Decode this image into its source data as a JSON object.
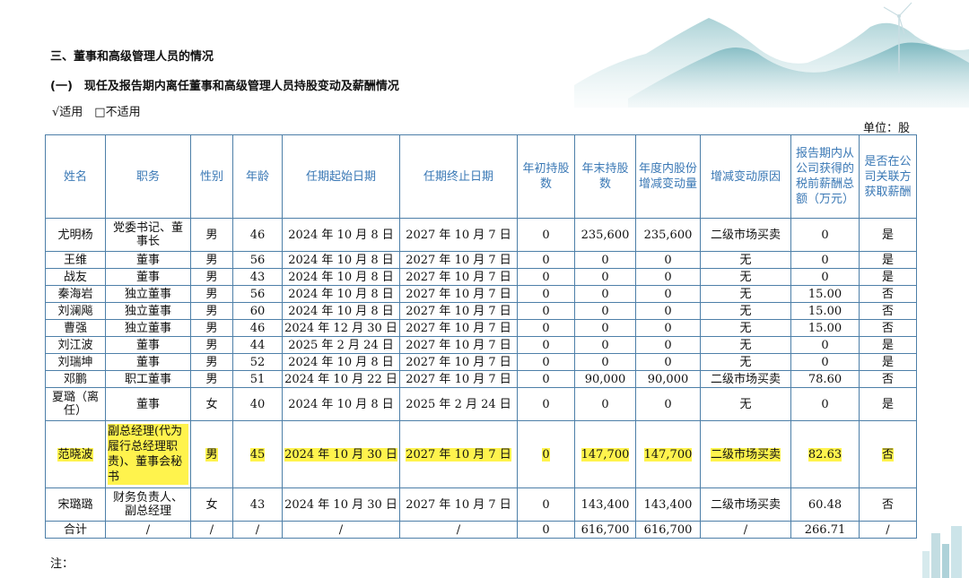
{
  "document": {
    "heading1": "三、董事和高级管理人员的情况",
    "heading2": "(一)　现任及报告期内离任董事和高级管理人员持股变动及薪酬情况",
    "applicability": "√适用　□不适用",
    "unit": "单位：股",
    "note": "注："
  },
  "table": {
    "headers": {
      "name": "姓名",
      "position": "职务",
      "gender": "性别",
      "age": "年龄",
      "start": "任期起始日期",
      "end": "任期终止日期",
      "begin_shares": "年初持股数",
      "end_shares": "年末持股数",
      "change": "年度内股份增减变动量",
      "reason": "增减变动原因",
      "pay": "报告期内从公司获得的税前薪酬总额（万元）",
      "related": "是否在公司关联方获取薪酬"
    },
    "rows": [
      {
        "name": "尤明杨",
        "position": "党委书记、董事长",
        "gender": "男",
        "age": "46",
        "start": "2024 年 10 月 8 日",
        "end": "2027 年 10 月 7 日",
        "begin_shares": "0",
        "end_shares": "235,600",
        "change": "235,600",
        "reason": "二级市场买卖",
        "pay": "0",
        "related": "是"
      },
      {
        "name": "王维",
        "position": "董事",
        "gender": "男",
        "age": "56",
        "start": "2024 年 10 月 8 日",
        "end": "2027 年 10 月 7 日",
        "begin_shares": "0",
        "end_shares": "0",
        "change": "0",
        "reason": "无",
        "pay": "0",
        "related": "是"
      },
      {
        "name": "战友",
        "position": "董事",
        "gender": "男",
        "age": "43",
        "start": "2024 年 10 月 8 日",
        "end": "2027 年 10 月 7 日",
        "begin_shares": "0",
        "end_shares": "0",
        "change": "0",
        "reason": "无",
        "pay": "0",
        "related": "是"
      },
      {
        "name": "秦海岩",
        "position": "独立董事",
        "gender": "男",
        "age": "56",
        "start": "2024 年 10 月 8 日",
        "end": "2027 年 10 月 7 日",
        "begin_shares": "0",
        "end_shares": "0",
        "change": "0",
        "reason": "无",
        "pay": "15.00",
        "related": "否"
      },
      {
        "name": "刘澜飚",
        "position": "独立董事",
        "gender": "男",
        "age": "60",
        "start": "2024 年 10 月 8 日",
        "end": "2027 年 10 月 7 日",
        "begin_shares": "0",
        "end_shares": "0",
        "change": "0",
        "reason": "无",
        "pay": "15.00",
        "related": "否"
      },
      {
        "name": "曹强",
        "position": "独立董事",
        "gender": "男",
        "age": "46",
        "start": "2024 年 12 月 30 日",
        "end": "2027 年 10 月 7 日",
        "begin_shares": "0",
        "end_shares": "0",
        "change": "0",
        "reason": "无",
        "pay": "15.00",
        "related": "否"
      },
      {
        "name": "刘江波",
        "position": "董事",
        "gender": "男",
        "age": "44",
        "start": "2025 年 2 月 24 日",
        "end": "2027 年 10 月 7 日",
        "begin_shares": "0",
        "end_shares": "0",
        "change": "0",
        "reason": "无",
        "pay": "0",
        "related": "是"
      },
      {
        "name": "刘瑞坤",
        "position": "董事",
        "gender": "男",
        "age": "52",
        "start": "2024 年 10 月 8 日",
        "end": "2027 年 10 月 7 日",
        "begin_shares": "0",
        "end_shares": "0",
        "change": "0",
        "reason": "无",
        "pay": "0",
        "related": "是"
      },
      {
        "name": "邓鹏",
        "position": "职工董事",
        "gender": "男",
        "age": "51",
        "start": "2024 年 10 月 22 日",
        "end": "2027 年 10 月 7 日",
        "begin_shares": "0",
        "end_shares": "90,000",
        "change": "90,000",
        "reason": "二级市场买卖",
        "pay": "78.60",
        "related": "否"
      },
      {
        "name": "夏璐（离任）",
        "position": "董事",
        "gender": "女",
        "age": "40",
        "start": "2024 年 10 月 8 日",
        "end": "2025 年 2 月 24 日",
        "begin_shares": "0",
        "end_shares": "0",
        "change": "0",
        "reason": "无",
        "pay": "0",
        "related": "是"
      },
      {
        "name": "范晓波",
        "position": "副总经理(代为履行总经理职责)、董事会秘书",
        "gender": "男",
        "age": "45",
        "start": "2024 年 10 月 30 日",
        "end": "2027 年 10 月 7 日",
        "begin_shares": "0",
        "end_shares": "147,700",
        "change": "147,700",
        "reason": "二级市场买卖",
        "pay": "82.63",
        "related": "否"
      },
      {
        "name": "宋璐璐",
        "position": "财务负责人、副总经理",
        "gender": "女",
        "age": "43",
        "start": "2024 年 10 月 30 日",
        "end": "2027 年 10 月 7 日",
        "begin_shares": "0",
        "end_shares": "143,400",
        "change": "143,400",
        "reason": "二级市场买卖",
        "pay": "60.48",
        "related": "否"
      }
    ],
    "total": {
      "name": "合计",
      "position": "/",
      "gender": "/",
      "age": "/",
      "start": "/",
      "end": "/",
      "begin_shares": "0",
      "end_shares": "616,700",
      "change": "616,700",
      "reason": "/",
      "pay": "266.71",
      "related": "/"
    }
  },
  "colors": {
    "header_text": "#3a78b5",
    "border": "#4d7fa8",
    "highlight": "#fff34d"
  }
}
